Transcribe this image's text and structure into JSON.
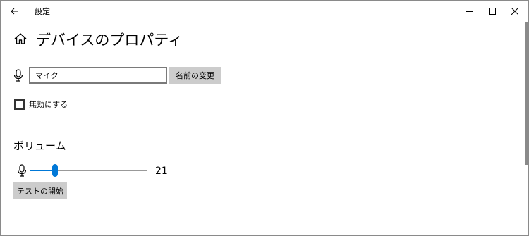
{
  "window": {
    "app_title": "設定",
    "icons": {
      "back": "arrow-left-icon",
      "minimize": "minimize-icon",
      "maximize": "maximize-icon",
      "close": "close-icon"
    }
  },
  "header": {
    "title": "デバイスのプロパティ",
    "icon": "home-icon"
  },
  "device_name": {
    "icon": "microphone-icon",
    "value": "マイク",
    "rename_label": "名前の変更"
  },
  "disable": {
    "label": "無効にする",
    "checked": false
  },
  "volume": {
    "heading": "ボリューム",
    "icon": "microphone-icon",
    "level": 21,
    "value_text": "21",
    "min": 0,
    "max": 100,
    "test_label": "テストの開始"
  },
  "colors": {
    "accent": "#0078d7",
    "button_bg": "#cccccc",
    "border": "#7a7a7a"
  }
}
